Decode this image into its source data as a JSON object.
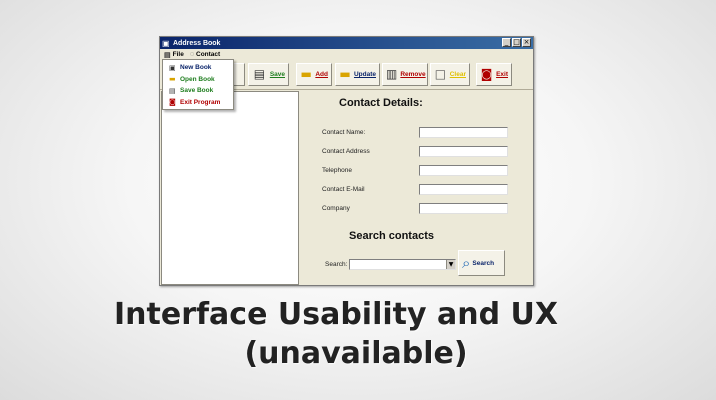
{
  "window": {
    "title": "Address Book",
    "minimize_glyph": "_",
    "maximize_glyph": "□",
    "close_glyph": "×"
  },
  "menubar": {
    "file_label": "File",
    "contact_label": "Contact"
  },
  "file_menu": {
    "items": [
      {
        "label": "New Book",
        "icon": "new-book-icon",
        "color": "#0a246a"
      },
      {
        "label": "Open Book",
        "icon": "open-book-icon",
        "color": "#1e7d1e"
      },
      {
        "label": "Save Book",
        "icon": "save-book-icon",
        "color": "#1e7d1e"
      },
      {
        "label": "Exit Program",
        "icon": "exit-icon",
        "color": "#b00000"
      }
    ]
  },
  "toolbar": {
    "open_partial_label": "en",
    "save_label": "Save",
    "add_label": "Add",
    "update_label": "Update",
    "remove_label": "Remove",
    "clear_label": "Clear",
    "exit_label": "Exit",
    "colors": {
      "save": "#1e7d1e",
      "add": "#b00000",
      "update": "#0a246a",
      "remove": "#b00000",
      "clear": "#e0c000",
      "exit": "#b00000"
    }
  },
  "contact_details": {
    "heading": "Contact Details:",
    "fields": [
      {
        "label": "Contact Name:",
        "value": ""
      },
      {
        "label": "Contact Address",
        "value": ""
      },
      {
        "label": "Telephone",
        "value": ""
      },
      {
        "label": "Contact E-Mail",
        "value": ""
      },
      {
        "label": "Company",
        "value": ""
      }
    ]
  },
  "search": {
    "heading": "Search contacts",
    "label": "Search:",
    "value": "",
    "button_label": "Search"
  },
  "caption": {
    "line1": "Interface Usability and UX",
    "line2": "(unavailable)"
  }
}
